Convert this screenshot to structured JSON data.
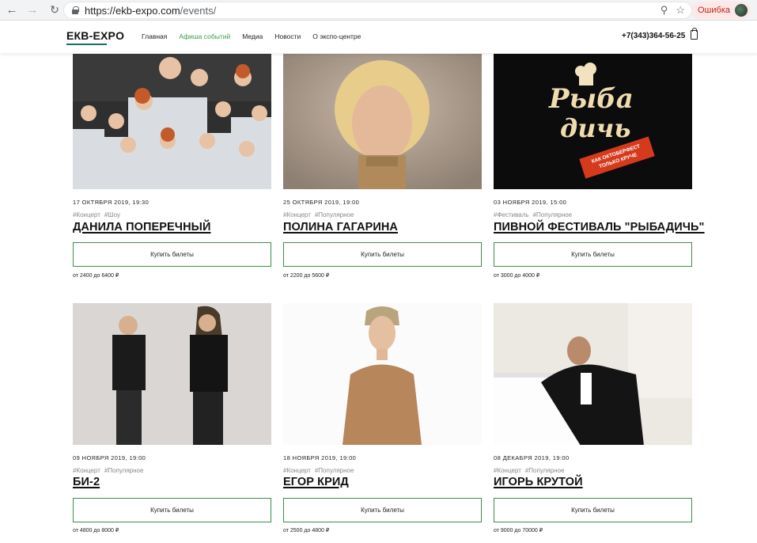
{
  "browser": {
    "url_host": "https://ekb-expo.com",
    "url_path": "/events/",
    "error_label": "Ошибка"
  },
  "site": {
    "logo": "ЕКВ-EXPO",
    "menu": [
      "Главная",
      "Афиша событий",
      "Медиа",
      "Новости",
      "О экспо-центре"
    ],
    "active_menu": "Афиша событий",
    "phone": "+7(343)364-56-25"
  },
  "events": [
    {
      "date": "17 ОКТЯБРЯ 2019, 19:30",
      "tags": [
        "#Концерт",
        "#Шоу"
      ],
      "title": "ДАНИЛА ПОПЕРЕЧНЫЙ",
      "buy_label": "Купить билеты",
      "price": "от 2400 до 6400 ₽"
    },
    {
      "date": "25 ОКТЯБРЯ 2019, 19:00",
      "tags": [
        "#Концерт",
        "#Популярное"
      ],
      "title": "ПОЛИНА ГАГАРИНА",
      "buy_label": "Купить билеты",
      "price": "от 2200 до 5600 ₽"
    },
    {
      "date": "03 НОЯБРЯ 2019, 15:00",
      "tags": [
        "#Фестиваль",
        "#Популярное"
      ],
      "title": "ПИВНОЙ ФЕСТИВАЛЬ \"РЫБАДИЧЬ\"",
      "buy_label": "Купить билеты",
      "price": "от 3000 до 4000 ₽",
      "poster_text": [
        "Рыба",
        "дичь",
        "КАК ОКТОБЕРФЕСТ",
        "ТОЛЬКО КРУЧЕ"
      ]
    },
    {
      "date": "09 НОЯБРЯ 2019, 19:00",
      "tags": [
        "#Концерт",
        "#Популярное"
      ],
      "title": "БИ-2",
      "buy_label": "Купить билеты",
      "price": "от 4800 до 8000 ₽"
    },
    {
      "date": "18 НОЯБРЯ 2019, 19:00",
      "tags": [
        "#Концерт",
        "#Популярное"
      ],
      "title": "ЕГОР КРИД",
      "buy_label": "Купить билеты",
      "price": "от 2500 до 4800 ₽"
    },
    {
      "date": "08 ДЕКАБРЯ 2019, 19:00",
      "tags": [
        "#Концерт",
        "#Популярное"
      ],
      "title": "ИГОРЬ КРУТОЙ",
      "buy_label": "Купить билеты",
      "price": "от 9000 до 70000 ₽"
    }
  ],
  "colors": {
    "accent": "#3a8f49",
    "logo_underline": "#1a6b74"
  }
}
